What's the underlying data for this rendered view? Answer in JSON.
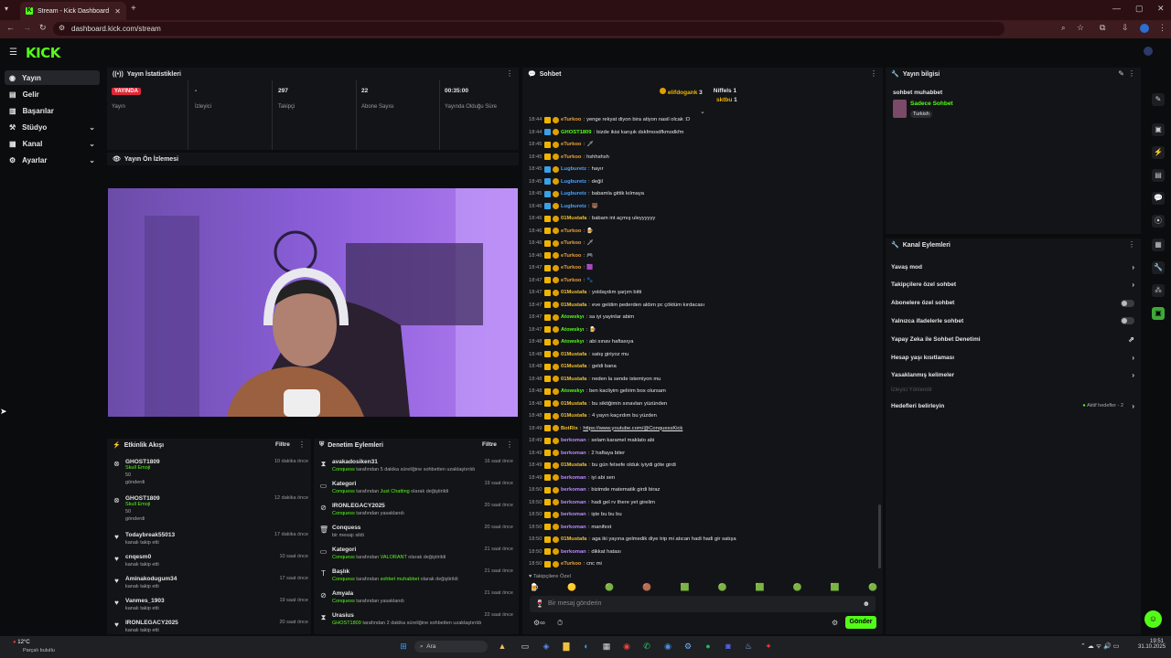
{
  "browser": {
    "tab_title": "Stream - Kick Dashboard",
    "url": "dashboard.kick.com/stream"
  },
  "header": {
    "logo": "KICK"
  },
  "sidebar": {
    "items": [
      {
        "label": "Yayın"
      },
      {
        "label": "Gelir"
      },
      {
        "label": "Başarılar"
      },
      {
        "label": "Stüdyo"
      },
      {
        "label": "Kanal"
      },
      {
        "label": "Ayarlar"
      }
    ]
  },
  "stats": {
    "title": "Yayın İstatistikleri",
    "live_badge": "YAYINDA",
    "items": [
      {
        "value": "",
        "label": "Yayın"
      },
      {
        "value": "-",
        "label": "İzleyici"
      },
      {
        "value": "297",
        "label": "Takipçi"
      },
      {
        "value": "22",
        "label": "Abone Sayısı"
      },
      {
        "value": "00:35:00",
        "label": "Yayında Olduğu Süre"
      }
    ]
  },
  "preview": {
    "title": "Yayın Ön İzlemesi"
  },
  "activity": {
    "title": "Etkinlik Akışı",
    "filter": "Filtre",
    "items": [
      {
        "name": "GHOST1809",
        "line1": "Skull Emoji",
        "line2": "50",
        "line3": "gönderdi",
        "time": "10 dakika önce",
        "icon": "kick-icon"
      },
      {
        "name": "GHOST1809",
        "line1": "Skull Emoji",
        "line2": "50",
        "line3": "gönderdi",
        "time": "12 dakika önce",
        "icon": "kick-icon"
      },
      {
        "name": "Todaybreak55013",
        "line1": "kanalı takip etti",
        "time": "17 dakika önce",
        "icon": "heart-icon"
      },
      {
        "name": "cnqesm0",
        "line1": "kanalı takip etti",
        "time": "10 saat önce",
        "icon": "heart-icon"
      },
      {
        "name": "Aminakodugum34",
        "line1": "kanalı takip etti",
        "time": "17 saat önce",
        "icon": "heart-icon"
      },
      {
        "name": "Vanmes_1903",
        "line1": "kanalı takip etti",
        "time": "19 saat önce",
        "icon": "heart-icon"
      },
      {
        "name": "IRONLEGACY2025",
        "line1": "kanalı takip etti",
        "time": "20 saat önce",
        "icon": "heart-icon"
      }
    ]
  },
  "moderation": {
    "title": "Denetim Eylemleri",
    "filter": "Filtre",
    "items": [
      {
        "title": "avakadosiken31",
        "who": "Conquess",
        "rest": " tarafından 5 dakika süreliğine sohbetten uzaklaştırıldı",
        "time": "16 saat önce"
      },
      {
        "title": "Kategori",
        "who": "Conquess",
        "rest": " tarafından ",
        "hl": "Just Chatting",
        "rest2": " olarak değiştirildi",
        "time": "19 saat önce"
      },
      {
        "title": "IRONLEGACY2025",
        "who": "Conquess",
        "rest": " tarafından yasaklandı",
        "time": "20 saat önce"
      },
      {
        "title": "Conquess",
        "who": "",
        "rest": "bir mesajı sildi",
        "time": "20 saat önce"
      },
      {
        "title": "Kategori",
        "who": "Conquess",
        "rest": " tarafından ",
        "hl": "VALORANT",
        "rest2": " olarak değiştirildi",
        "time": "21 saat önce"
      },
      {
        "title": "Başlık",
        "who": "Conquess",
        "rest": " tarafından ",
        "hl": "sohbet muhabbet",
        "rest2": " olarak değiştirildi",
        "time": "21 saat önce"
      },
      {
        "title": "Amyala",
        "who": "Conquess",
        "rest": " tarafından yasaklandı",
        "time": "21 saat önce"
      },
      {
        "title": "Urasius",
        "who": "GHOST1809",
        "rest": " tarafından 2 dakika süreliğine sohbetten uzaklaştırıldı",
        "time": "22 saat önce"
      }
    ]
  },
  "chat": {
    "title": "Sohbet",
    "pinned": [
      {
        "name": "elifdogank",
        "count": "3"
      },
      {
        "name": "Niffels",
        "count": "1"
      },
      {
        "name": "sktbu",
        "count": "1"
      }
    ],
    "messages": [
      {
        "t": "18:44",
        "u": "eTurkoo",
        "c": "#e8a13a",
        "m": "yenge rekyat diyon bira atiyon nasil olcak :D"
      },
      {
        "t": "18:44",
        "u": "GHOST1809",
        "c": "#53fc18",
        "m": "bizde ikisi karışık dskfmosdfkmodkfm"
      },
      {
        "t": "18:45",
        "u": "eTurkoo",
        "c": "#e8a13a",
        "m": "🗡"
      },
      {
        "t": "18:45",
        "u": "eTurkoo",
        "c": "#e8a13a",
        "m": "hshhshsh"
      },
      {
        "t": "18:45",
        "u": "Lugburetz",
        "c": "#4aa3ff",
        "m": "hayır"
      },
      {
        "t": "18:45",
        "u": "Lugburetz",
        "c": "#4aa3ff",
        "m": "değil"
      },
      {
        "t": "18:45",
        "u": "Lugburetz",
        "c": "#4aa3ff",
        "m": "babamla gittik kılmaya"
      },
      {
        "t": "18:46",
        "u": "Lugburetz",
        "c": "#4aa3ff",
        "m": "🐻"
      },
      {
        "t": "18:46",
        "u": "01Mustafa",
        "c": "#f0c030",
        "m": "babam int açmış uleyyyyyy"
      },
      {
        "t": "18:46",
        "u": "eTurkoo",
        "c": "#e8a13a",
        "m": "🍺"
      },
      {
        "t": "18:46",
        "u": "eTurkoo",
        "c": "#e8a13a",
        "m": "🗡"
      },
      {
        "t": "18:46",
        "u": "eTurkoo",
        "c": "#e8a13a",
        "m": "🎮"
      },
      {
        "t": "18:47",
        "u": "eTurkoo",
        "c": "#e8a13a",
        "m": "🟪"
      },
      {
        "t": "18:47",
        "u": "eTurkoo",
        "c": "#e8a13a",
        "m": "🐾"
      },
      {
        "t": "18:47",
        "u": "01Mustafa",
        "c": "#f0c030",
        "m": "yoldaydım şarjım bitti"
      },
      {
        "t": "18:47",
        "u": "01Mustafa",
        "c": "#f0c030",
        "m": "eve geldim pederden aldım pc çöktüm kırdacası"
      },
      {
        "t": "18:47",
        "u": "Atowskyı",
        "c": "#53fc18",
        "m": "sa iyi yayinlar abim"
      },
      {
        "t": "18:47",
        "u": "Atowskyı",
        "c": "#53fc18",
        "m": "🍺"
      },
      {
        "t": "18:48",
        "u": "Atowskyı",
        "c": "#53fc18",
        "m": "abi sınav haftasıya"
      },
      {
        "t": "18:48",
        "u": "01Mustafa",
        "c": "#f0c030",
        "m": "satış giriyoz mu"
      },
      {
        "t": "18:48",
        "u": "01Mustafa",
        "c": "#f0c030",
        "m": "geldi bana"
      },
      {
        "t": "18:48",
        "u": "01Mustafa",
        "c": "#f0c030",
        "m": "neden la sende istemiyon mu"
      },
      {
        "t": "18:48",
        "u": "Atowskyı",
        "c": "#53fc18",
        "m": "ben kacliyim gelirim bos olursam"
      },
      {
        "t": "18:48",
        "u": "01Mustafa",
        "c": "#f0c030",
        "m": "bu siktiğimin sınavları yüzünden"
      },
      {
        "t": "18:48",
        "u": "01Mustafa",
        "c": "#f0c030",
        "m": "4 yayın kaçırdım bu yüzden"
      },
      {
        "t": "18:49",
        "u": "BotRix",
        "c": "#f0c030",
        "m": "https://www.youtube.com/@ConquessKick",
        "link": true
      },
      {
        "t": "18:49",
        "u": "berkoman",
        "c": "#b98aff",
        "m": "selam karamel maklato abi"
      },
      {
        "t": "18:49",
        "u": "berkoman",
        "c": "#b98aff",
        "m": "2 haftaya biter"
      },
      {
        "t": "18:49",
        "u": "01Mustafa",
        "c": "#f0c030",
        "m": "bu gün felsefe olduk iyiydi göte girdi"
      },
      {
        "t": "18:49",
        "u": "berkoman",
        "c": "#b98aff",
        "m": "iyi abi sen"
      },
      {
        "t": "18:50",
        "u": "berkoman",
        "c": "#b98aff",
        "m": "bizimde matematik girdi biraz"
      },
      {
        "t": "18:50",
        "u": "berkoman",
        "c": "#b98aff",
        "m": "hadi gel rv there yet girelim"
      },
      {
        "t": "18:50",
        "u": "berkoman",
        "c": "#b98aff",
        "m": "işte bu bu bu"
      },
      {
        "t": "18:50",
        "u": "berkoman",
        "c": "#b98aff",
        "m": "manifest"
      },
      {
        "t": "18:50",
        "u": "01Mustafa",
        "c": "#f0c030",
        "m": "aga iki yayına gelmedik diye trip mi atıcan hadi hadi gir satışa"
      },
      {
        "t": "18:50",
        "u": "berkoman",
        "c": "#b98aff",
        "m": "dikkat hatası"
      },
      {
        "t": "18:50",
        "u": "eTurkoo",
        "c": "#e8a13a",
        "m": "cnc mi"
      }
    ],
    "followers_only": "Takipçilere Özel",
    "input_placeholder": "Bir mesaj gönderin",
    "send": "Gönder"
  },
  "stream_info": {
    "title": "Yayın bilgisi",
    "stream_title": "sohbet muhabbet",
    "category": "Sadece Sohbet",
    "tag": "Turkish"
  },
  "channel_actions": {
    "title": "Kanal Eylemleri",
    "items": [
      {
        "label": "Yavaş mod",
        "ctl": "chevron"
      },
      {
        "label": "Takipçilere özel sohbet",
        "ctl": "chevron"
      },
      {
        "label": "Abonelere özel sohbet",
        "ctl": "toggle"
      },
      {
        "label": "Yalnızca ifadelerle sohbet",
        "ctl": "toggle"
      },
      {
        "label": "Yapay Zeka ile Sohbet Denetimi",
        "ctl": "external"
      },
      {
        "label": "Hesap yaşı kısıtlaması",
        "ctl": "chevron"
      },
      {
        "label": "Yasaklanmış kelimeler",
        "ctl": "chevron"
      }
    ],
    "section": "İzleyici Yönlendir",
    "goals": "Hedefleri belirleyin",
    "goals_status": "Aktif hedefler - 2"
  },
  "taskbar": {
    "weather_temp": "12°C",
    "weather_desc": "Parçalı bulutlu",
    "search": "Ara",
    "time": "19:51",
    "date": "31.10.2025"
  }
}
